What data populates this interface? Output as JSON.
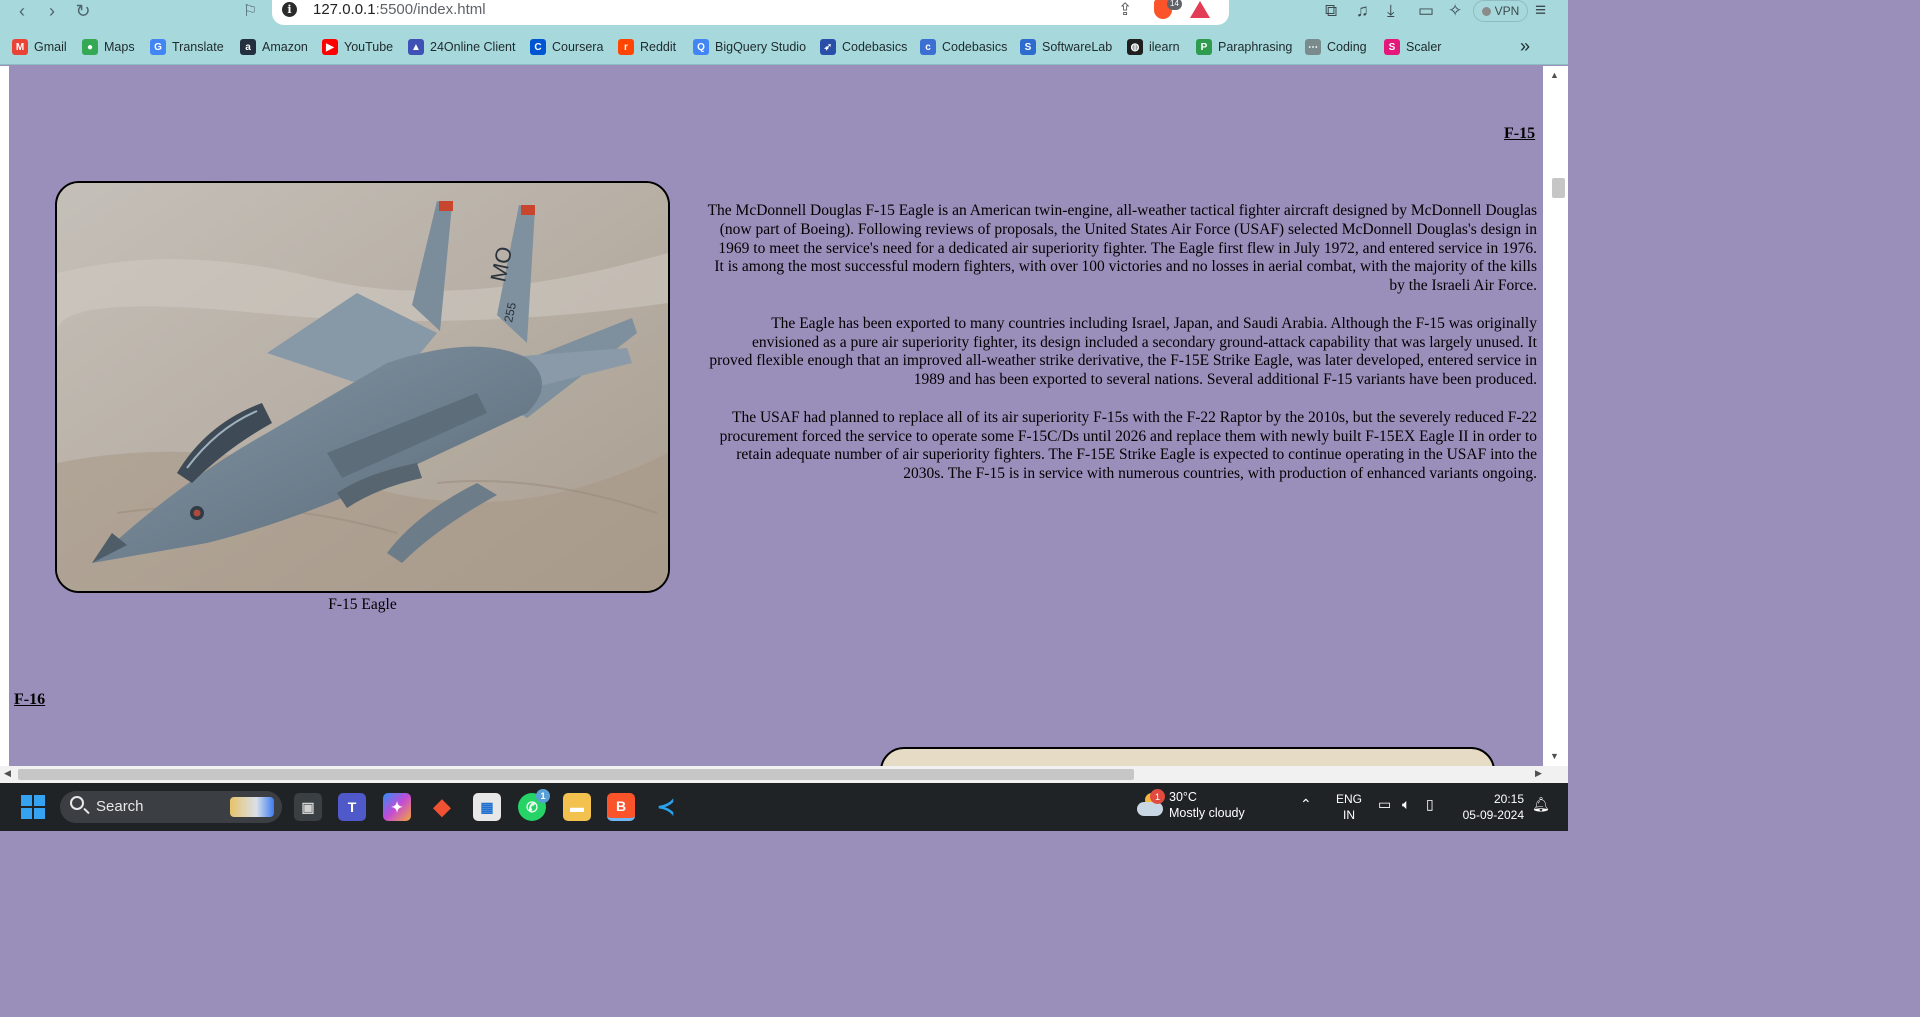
{
  "browser": {
    "url_host": "127.0.0.1",
    "url_rest": ":5500/index.html",
    "brave_badge_count": "14",
    "vpn_label": "VPN",
    "bookmarks": [
      {
        "label": "Gmail",
        "icon": "gmail-icon",
        "color": "#ea4335",
        "glyph": "M"
      },
      {
        "label": "Maps",
        "icon": "maps-icon",
        "color": "#34a853",
        "glyph": "●"
      },
      {
        "label": "Translate",
        "icon": "translate-icon",
        "color": "#4285f4",
        "glyph": "G"
      },
      {
        "label": "Amazon",
        "icon": "amazon-icon",
        "color": "#232f3e",
        "glyph": "a"
      },
      {
        "label": "YouTube",
        "icon": "youtube-icon",
        "color": "#ff0000",
        "glyph": "▶"
      },
      {
        "label": "24Online Client",
        "icon": "24online-icon",
        "color": "#3f51b5",
        "glyph": "▲"
      },
      {
        "label": "Coursera",
        "icon": "coursera-icon",
        "color": "#0056d2",
        "glyph": "C"
      },
      {
        "label": "Reddit",
        "icon": "reddit-icon",
        "color": "#ff4500",
        "glyph": "r"
      },
      {
        "label": "BigQuery Studio",
        "icon": "bigquery-icon",
        "color": "#4285f4",
        "glyph": "Q"
      },
      {
        "label": "Codebasics",
        "icon": "rocket-icon",
        "color": "#2a4fa8",
        "glyph": "➶"
      },
      {
        "label": "Codebasics",
        "icon": "codebasics-icon",
        "color": "#3b6fd1",
        "glyph": "c"
      },
      {
        "label": "SoftwareLab",
        "icon": "softwarelab-icon",
        "color": "#2d6bcf",
        "glyph": "S"
      },
      {
        "label": "ilearn",
        "icon": "globe-icon",
        "color": "#1f1f1f",
        "glyph": "◍"
      },
      {
        "label": "Paraphrasing",
        "icon": "paraphrasing-icon",
        "color": "#2e9b4f",
        "glyph": "P"
      },
      {
        "label": "Coding",
        "icon": "coding-icon",
        "color": "#7a8b8e",
        "glyph": "⋯"
      },
      {
        "label": "Scaler",
        "icon": "scaler-icon",
        "color": "#e5177b",
        "glyph": "S"
      }
    ]
  },
  "page": {
    "heading_f15": "F-15",
    "caption_f15": "F-15 Eagle",
    "paragraphs_f15": [
      "The McDonnell Douglas F-15 Eagle is an American twin-engine, all-weather tactical fighter aircraft designed by McDonnell Douglas (now part of Boeing). Following reviews of proposals, the United States Air Force (USAF) selected McDonnell Douglas's design in 1969 to meet the service's need for a dedicated air superiority fighter. The Eagle first flew in July 1972, and entered service in 1976. It is among the most successful modern fighters, with over 100 victories and no losses in aerial combat, with the majority of the kills by the Israeli Air Force.",
      "The Eagle has been exported to many countries including Israel, Japan, and Saudi Arabia. Although the F-15 was originally envisioned as a pure air superiority fighter, its design included a secondary ground-attack capability that was largely unused. It proved flexible enough that an improved all-weather strike derivative, the F-15E Strike Eagle, was later developed, entered service in 1989 and has been exported to several nations. Several additional F-15 variants have been produced.",
      "The USAF had planned to replace all of its air superiority F-15s with the F-22 Raptor by the 2010s, but the severely reduced F-22 procurement forced the service to operate some F-15C/Ds until 2026 and replace them with newly built F-15EX Eagle II in order to retain adequate number of air superiority fighters. The F-15E Strike Eagle is expected to continue operating in the USAF into the 2030s. The F-15 is in service with numerous countries, with production of enhanced variants ongoing."
    ],
    "tail_code": "MO",
    "tail_number": "255",
    "heading_f16": "F-16"
  },
  "taskbar": {
    "search_label": "Search",
    "whatsapp_badge": "1",
    "weather_badge": "1",
    "weather_temp": "30°C",
    "weather_desc": "Mostly cloudy",
    "lang_top": "ENG",
    "lang_bottom": "IN",
    "time": "20:15",
    "date": "05-09-2024"
  },
  "colors": {
    "page_background": "#9a8fba",
    "browser_chrome": "#a6d8dc",
    "taskbar": "#1f2326"
  }
}
